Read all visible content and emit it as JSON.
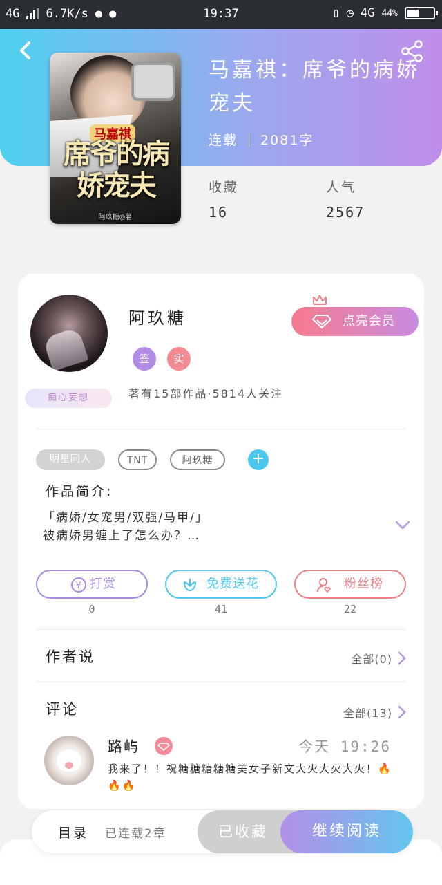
{
  "status_bar": {
    "network": "4G",
    "speed": "6.7K/s",
    "time": "19:37",
    "network_right": "4G",
    "battery": "44%"
  },
  "book": {
    "cover_series": "马嘉祺",
    "cover_title": "席爷的病娇宠夫",
    "cover_author": "阿玖糖◎著",
    "title": "马嘉祺：席爷的病娇宠夫",
    "status": "连载",
    "word_count": "2081字",
    "favorites_label": "收藏",
    "favorites_value": "16",
    "popularity_label": "人气",
    "popularity_value": "2567"
  },
  "author": {
    "name": "阿玖糖",
    "badge_signed": "签",
    "badge_verified": "实",
    "pendant": "痴心妄想",
    "stats": "著有15部作品·5814人关注",
    "vip_button": "点亮会员"
  },
  "tags": [
    "明星同人",
    "TNT",
    "阿玖糖"
  ],
  "intro": {
    "label": "作品简介:",
    "line1": "「病娇/女宠男/双强/马甲/」",
    "line2": "被病娇男缠上了怎么办？…"
  },
  "actions": [
    {
      "label": "打赏",
      "count": "0"
    },
    {
      "label": "免费送花",
      "count": "41"
    },
    {
      "label": "粉丝榜",
      "count": "22"
    }
  ],
  "author_says": {
    "title": "作者说",
    "all": "全部(0)"
  },
  "comments": {
    "title": "评论",
    "all": "全部(13)",
    "items": [
      {
        "user": "路屿",
        "time": "今天 19:26",
        "text": "我来了！！祝糖糖糖糖糖美女子新文大火大火大火！🔥🔥🔥"
      }
    ]
  },
  "bottom_bar": {
    "toc_label": "目录",
    "toc_sub": "已连载2章",
    "favorited": "已收藏",
    "continue": "继续阅读"
  },
  "colors": {
    "hero_start": "#4fd0ef",
    "hero_end": "#c08ee9",
    "reward": "#a88be0",
    "flower": "#4cc7ee",
    "fans": "#f07f8a"
  }
}
